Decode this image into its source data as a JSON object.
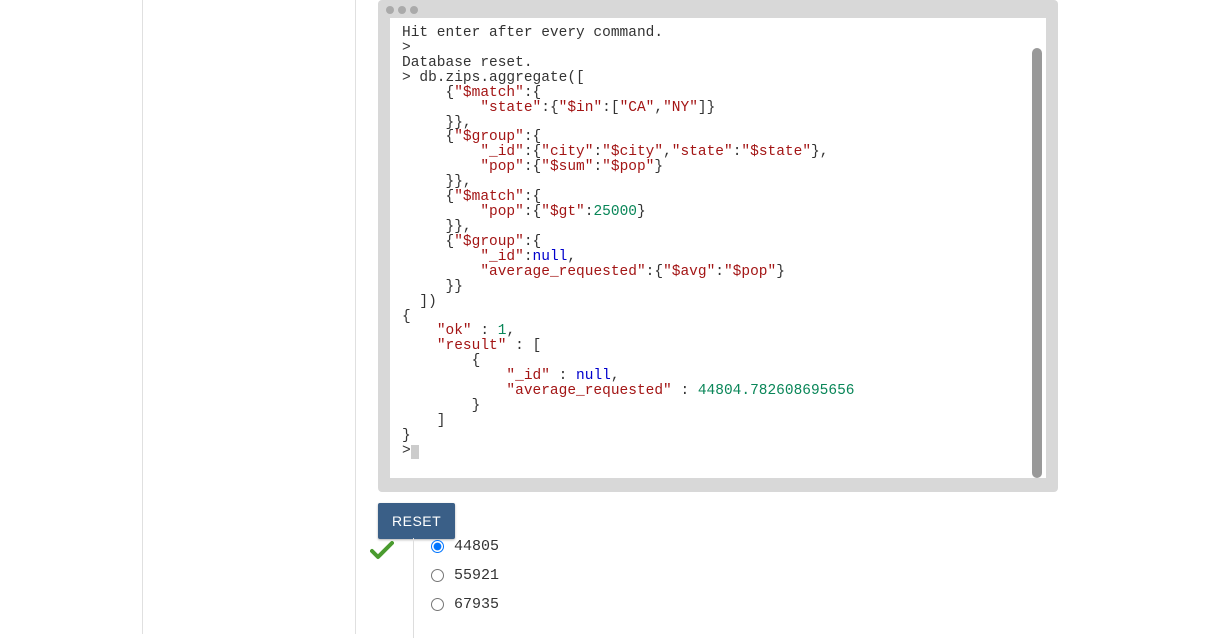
{
  "terminal": {
    "intro1": "Hit enter after every command.",
    "prompt": ">",
    "reset_msg": "Database reset.",
    "cmd_prefix": "> ",
    "cmd_head": "db.zips.aggregate([",
    "stage1": {
      "op": "\"$match\"",
      "field": "\"state\"",
      "in_op": "\"$in\"",
      "vals": [
        "\"CA\"",
        "\"NY\""
      ]
    },
    "stage2": {
      "op": "\"$group\"",
      "id_key": "\"_id\"",
      "city_k": "\"city\"",
      "city_v": "\"$city\"",
      "state_k": "\"state\"",
      "state_v": "\"$state\"",
      "pop_k": "\"pop\"",
      "sum_k": "\"$sum\"",
      "pop_v": "\"$pop\""
    },
    "stage3": {
      "op": "\"$match\"",
      "pop_k": "\"pop\"",
      "gt_k": "\"$gt\"",
      "gt_v": "25000"
    },
    "stage4": {
      "op": "\"$group\"",
      "id_k": "\"_id\"",
      "id_v": "null",
      "avg_k": "\"average_requested\"",
      "avg_op": "\"$avg\"",
      "avg_v": "\"$pop\""
    },
    "result": {
      "ok_k": "\"ok\"",
      "ok_v": "1",
      "res_k": "\"result\"",
      "id_k": "\"_id\"",
      "id_v": "null",
      "avg_k": "\"average_requested\"",
      "avg_v": "44804.782608695656"
    }
  },
  "reset_button": "RESET",
  "answers": [
    {
      "label": "44805",
      "checked": true
    },
    {
      "label": "55921",
      "checked": false
    },
    {
      "label": "67935",
      "checked": false
    }
  ]
}
